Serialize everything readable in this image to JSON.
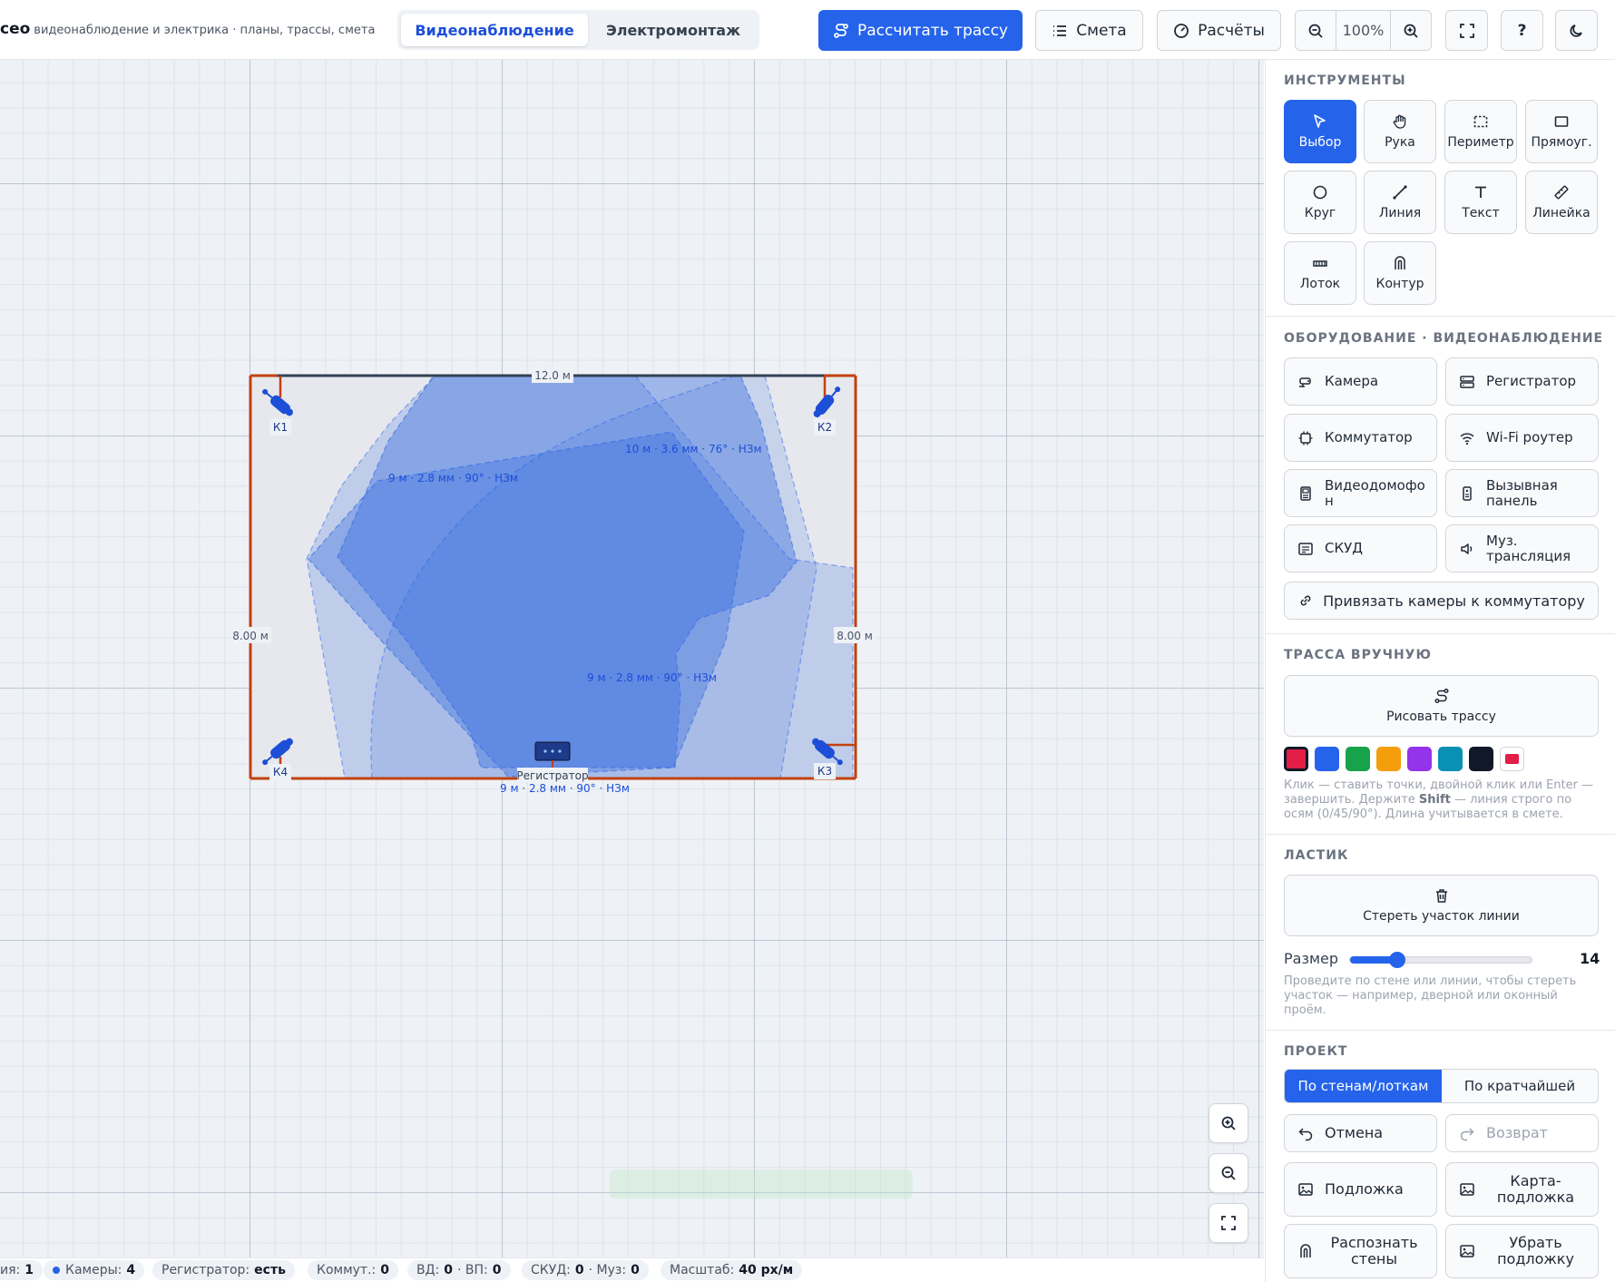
{
  "header": {
    "brand": "ceo",
    "subtitle": "видеонаблюдение и электрика · планы, трассы, смета",
    "modes": [
      "Видеонаблюдение",
      "Электромонтаж"
    ],
    "calc_route": "Рассчитать трассу",
    "estimate": "Смета",
    "calculations": "Расчёты",
    "zoom": "100%",
    "help": "?"
  },
  "plan": {
    "width_label": "12.0 м",
    "left_height_label": "8.00 м",
    "right_height_label": "8.00 м",
    "cameras": [
      {
        "id": "К1",
        "spec": "9 м · 2.8 мм · 90° · НЗм"
      },
      {
        "id": "К2",
        "spec": "10 м · 3.6 мм · 76° · НЗм"
      },
      {
        "id": "К3",
        "spec": "9 м · 2.8 мм · 90° · НЗм"
      },
      {
        "id": "К4",
        "spec": "9 м · 2.8 мм · 90° · НЗм"
      }
    ],
    "recorder_label": "Регистратор"
  },
  "status": {
    "c0_label": "ия:",
    "c0_value": "1",
    "cameras_label": "Камеры:",
    "cameras_value": "4",
    "recorder_label": "Регистратор:",
    "recorder_value": "есть",
    "switch_label": "Коммут.:",
    "switch_value": "0",
    "vd_label": "ВД:",
    "vd_value": "0",
    "vp_label": "· ВП:",
    "vp_value": "0",
    "skud_label": "СКУД:",
    "skud_value": "0",
    "muz_label": "· Муз:",
    "muz_value": "0",
    "scale_label": "Масштаб:",
    "scale_value": "40 px/м"
  },
  "sidebar": {
    "tools_title": "ИНСТРУМЕНТЫ",
    "tools": [
      "Выбор",
      "Рука",
      "Периметр",
      "Прямоуг.",
      "Круг",
      "Линия",
      "Текст",
      "Линейка",
      "Лоток",
      "Контур"
    ],
    "equipment_title": "ОБОРУДОВАНИЕ · ВИДЕОНАБЛЮДЕНИЕ",
    "equipment": [
      "Камера",
      "Регистратор",
      "Коммутатор",
      "Wi-Fi роутер",
      "Видеодомофо н",
      "Вызывная панель",
      "СКУД",
      "Муз. трансляция"
    ],
    "bind_cameras": "Привязать камеры к коммутатору",
    "manual_title": "ТРАССА ВРУЧНУЮ",
    "draw_route": "Рисовать трассу",
    "colors": [
      "#e11d48",
      "#2563eb",
      "#16a34a",
      "#f59e0b",
      "#9333ea",
      "#0891b2",
      "#111827",
      "#e11d48"
    ],
    "manual_hint_a": "Клик — ставить точки, двойной клик или Enter — завершить. Держите ",
    "manual_hint_b": "Shift",
    "manual_hint_c": " — линия строго по осям (0/45/90°). Длина учитывается в смете.",
    "eraser_title": "ЛАСТИК",
    "erase_segment": "Стереть участок линии",
    "size_label": "Размер",
    "size_value": "14",
    "size_fraction": 0.26,
    "eraser_hint": "Проведите по стене или линии, чтобы стереть участок — например, дверной или оконный проём.",
    "project_title": "ПРОЕКТ",
    "route_modes": [
      "По стенам/лоткам",
      "По кратчайшей"
    ],
    "undo": "Отмена",
    "redo": "Возврат",
    "underlay": "Подложка",
    "map_underlay": "Карта-подложка",
    "recognize_walls": "Распознать стены",
    "remove_underlay": "Убрать подложку"
  }
}
